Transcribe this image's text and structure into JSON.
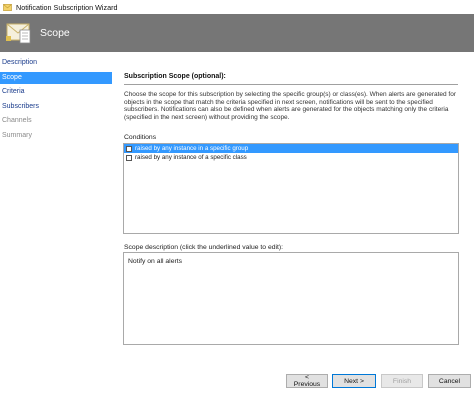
{
  "window": {
    "title": "Notification Subscription Wizard"
  },
  "banner": {
    "heading": "Scope"
  },
  "nav": {
    "items": [
      {
        "label": "Description"
      },
      {
        "label": "Scope"
      },
      {
        "label": "Criteria"
      },
      {
        "label": "Subscribers"
      },
      {
        "label": "Channels"
      },
      {
        "label": "Summary"
      }
    ],
    "selected": "Scope"
  },
  "main": {
    "section_title": "Subscription Scope (optional):",
    "description": "Choose the scope for this subscription by selecting the specific group(s) or class(es). When alerts are generated for objects in the scope that match the criteria specified in next screen, notifications will be sent to the specified subscribers. Notifications can also be defined when alerts are generated for the objects matching only the criteria (specified in the next screen) without providing the scope.",
    "conditions_label": "Conditions",
    "conditions": [
      {
        "label": "raised by any instance in a specific group",
        "checked": false,
        "selected": true
      },
      {
        "label": "raised by any instance of a specific class",
        "checked": false,
        "selected": false
      }
    ],
    "scope_description_label": "Scope description (click the underlined value to edit):",
    "scope_description_text": "Notify on all alerts"
  },
  "buttons": {
    "previous": "< Previous",
    "next": "Next >",
    "finish": "Finish",
    "cancel": "Cancel"
  },
  "colors": {
    "banner": "#767676",
    "selection": "#3399ff",
    "nav_link": "#1a3c8c",
    "nav_disabled": "#8a8a8a"
  }
}
